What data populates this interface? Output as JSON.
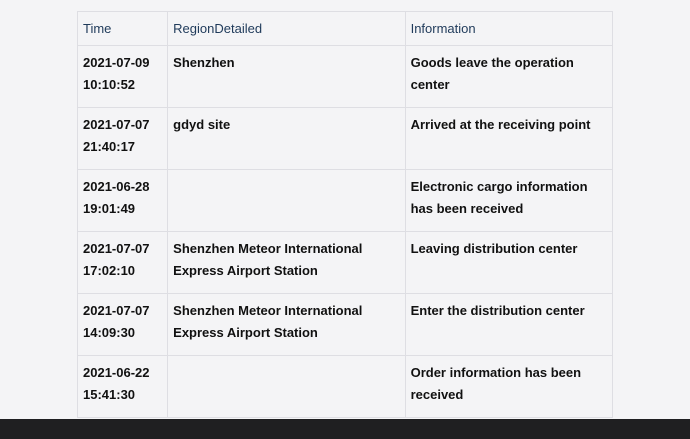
{
  "table": {
    "headers": {
      "time": "Time",
      "region": "RegionDetailed",
      "info": "Information"
    },
    "rows": [
      {
        "date": "2021-07-09",
        "clock": "10:10:52",
        "region": "Shenzhen",
        "info": "Goods leave the operation center"
      },
      {
        "date": "2021-07-07",
        "clock": "21:40:17",
        "region": "gdyd site",
        "info": "Arrived at the receiving point"
      },
      {
        "date": "2021-06-28",
        "clock": "19:01:49",
        "region": "",
        "info": "Electronic cargo information has been received"
      },
      {
        "date": "2021-07-07",
        "clock": "17:02:10",
        "region": "Shenzhen Meteor International Express Airport Station",
        "info": "Leaving distribution center"
      },
      {
        "date": "2021-07-07",
        "clock": "14:09:30",
        "region": "Shenzhen Meteor International Express Airport Station",
        "info": "Enter the distribution center"
      },
      {
        "date": "2021-06-22",
        "clock": "15:41:30",
        "region": "",
        "info": "Order information has been received"
      }
    ]
  }
}
